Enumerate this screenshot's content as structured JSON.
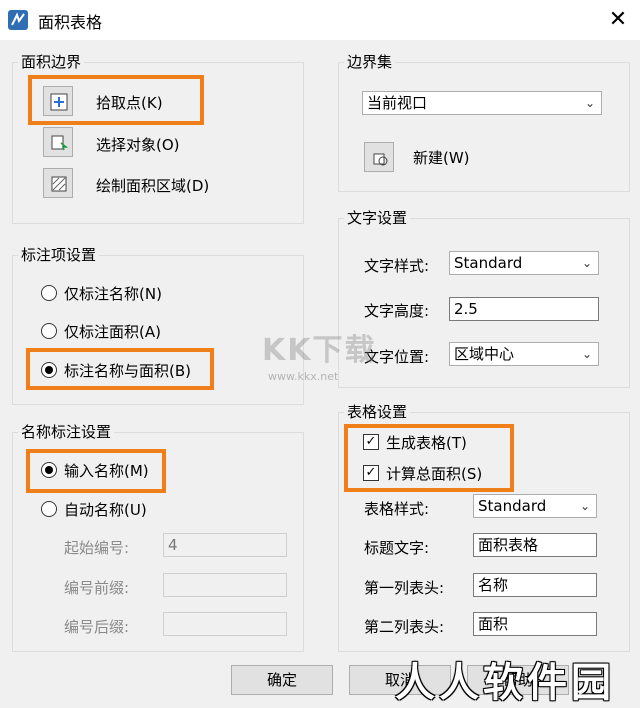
{
  "window": {
    "title": "面积表格",
    "close_glyph": "✕"
  },
  "boundary_group": {
    "legend": "面积边界",
    "pick_point": "拾取点(K)",
    "select_object": "选择对象(O)",
    "draw_area": "绘制面积区域(D)"
  },
  "boundary_set_group": {
    "legend": "边界集",
    "current_value": "当前视口",
    "new_label": "新建(W)"
  },
  "annotation_group": {
    "legend": "标注项设置",
    "options": [
      "仅标注名称(N)",
      "仅标注面积(A)",
      "标注名称与面积(B)"
    ],
    "selected_index": 2
  },
  "text_group": {
    "legend": "文字设置",
    "style_label": "文字样式:",
    "style_value": "Standard",
    "height_label": "文字高度:",
    "height_value": "2.5",
    "position_label": "文字位置:",
    "position_value": "区域中心"
  },
  "name_group": {
    "legend": "名称标注设置",
    "input_name": "输入名称(M)",
    "auto_name": "自动名称(U)",
    "start_label": "起始编号:",
    "start_value": "4",
    "prefix_label": "编号前缀:",
    "prefix_value": "",
    "suffix_label": "编号后缀:",
    "suffix_value": "",
    "selected": "input_name"
  },
  "table_group": {
    "legend": "表格设置",
    "generate_table": "生成表格(T)",
    "generate_checked": true,
    "compute_total": "计算总面积(S)",
    "compute_checked": true,
    "table_style_label": "表格样式:",
    "table_style_value": "Standard",
    "title_label": "标题文字:",
    "title_value": "面积表格",
    "col1_label": "第一列表头:",
    "col1_value": "名称",
    "col2_label": "第二列表头:",
    "col2_value": "面积"
  },
  "buttons": {
    "ok": "确定",
    "cancel": "取消",
    "help": "帮助"
  },
  "check_glyph": "✓",
  "dropdown_glyph": "⌄",
  "watermarks": {
    "kkx": "KK下载",
    "kkx_url": "www.kkx.net",
    "rrz": "人人软件园"
  },
  "colors": {
    "highlight": "#f07f1a",
    "dialog_bg": "#f0f0f0"
  }
}
